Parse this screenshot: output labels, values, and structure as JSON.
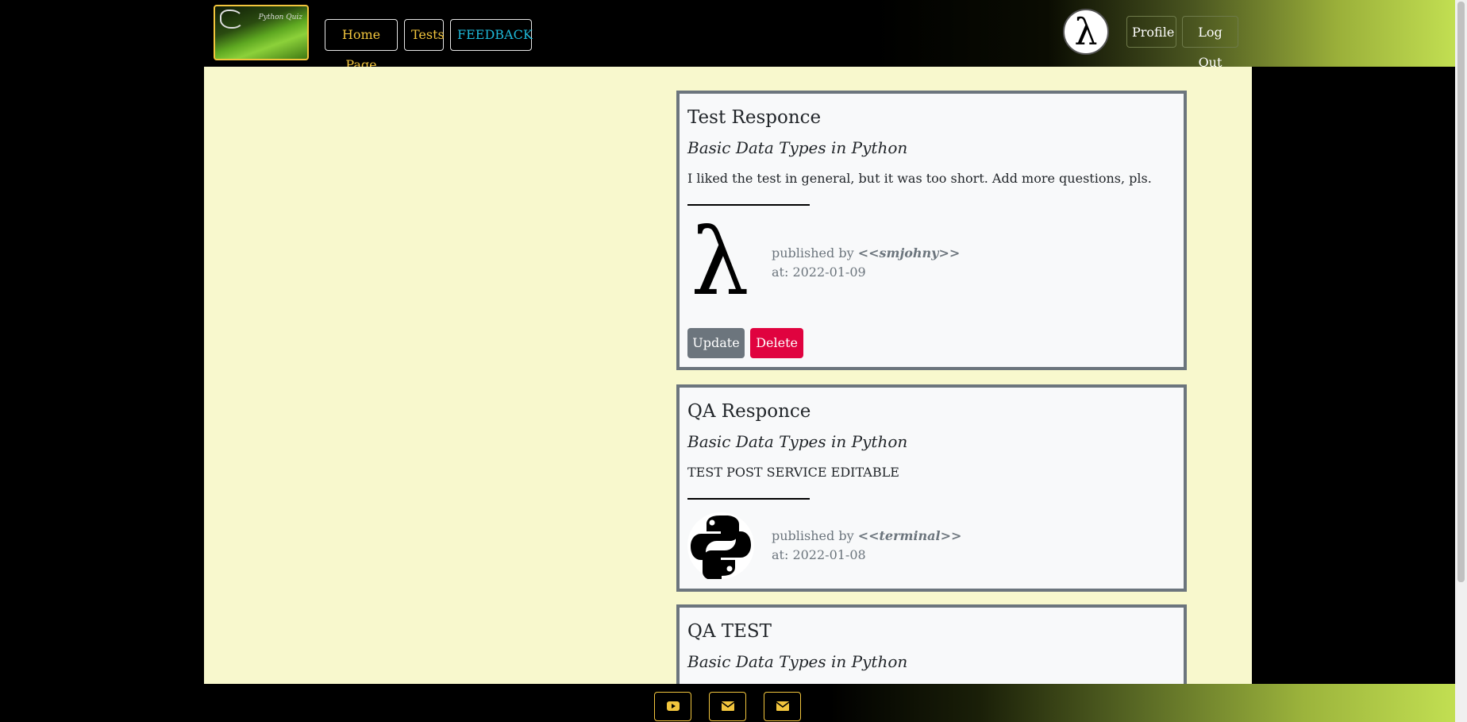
{
  "nav": {
    "logo_text": "Python Quiz",
    "home_label": "Home Page",
    "tests_label": "Tests",
    "feedback_label": "FEEDBACK",
    "avatar_glyph": "λ",
    "profile_label": "Profile",
    "logout_label": "Log Out"
  },
  "cards": [
    {
      "title": "Test Responce",
      "subtitle": "Basic Data Types in Python",
      "text": "I liked the test in general, but it was too short. Add more questions, pls.",
      "published_prefix": "published by ",
      "author": "<<smjohny>>",
      "date": "at: 2022-01-09",
      "avatar_glyph": "λ",
      "update_label": "Update",
      "delete_label": "Delete"
    },
    {
      "title": "QA Responce",
      "subtitle": "Basic Data Types in Python",
      "text": "TEST POST SERVICE EDITABLE",
      "published_prefix": "published by ",
      "author": "<<terminal>>",
      "date": "at: 2022-01-08"
    },
    {
      "title": "QA TEST",
      "subtitle": "Basic Data Types in Python"
    }
  ],
  "footer": {
    "icons": [
      "youtube-icon",
      "envelope-icon",
      "envelope-icon"
    ],
    "accent": "#f2c53d"
  },
  "colors": {
    "nav_accent": "#f2c53d",
    "feedback": "#1eb8d8",
    "main_bg": "#f8f8cd",
    "card_border": "#6c757d",
    "delete": "#e0033f",
    "update": "#6c757d"
  }
}
